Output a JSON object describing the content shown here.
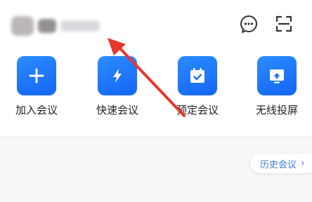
{
  "header": {
    "icons": [
      "chat-bubble-icon",
      "scan-icon"
    ]
  },
  "actions": [
    {
      "label": "加入会议",
      "icon": "plus-icon"
    },
    {
      "label": "快速会议",
      "icon": "lightning-icon"
    },
    {
      "label": "预定会议",
      "icon": "calendar-check-icon"
    },
    {
      "label": "无线投屏",
      "icon": "screen-cast-icon"
    }
  ],
  "history": {
    "label": "历史会议",
    "chevron": "›"
  },
  "colors": {
    "accent": "#1a73f7",
    "link": "#3a7bd5",
    "annotation": "#e8362b",
    "panel": "#f7f8fa"
  }
}
